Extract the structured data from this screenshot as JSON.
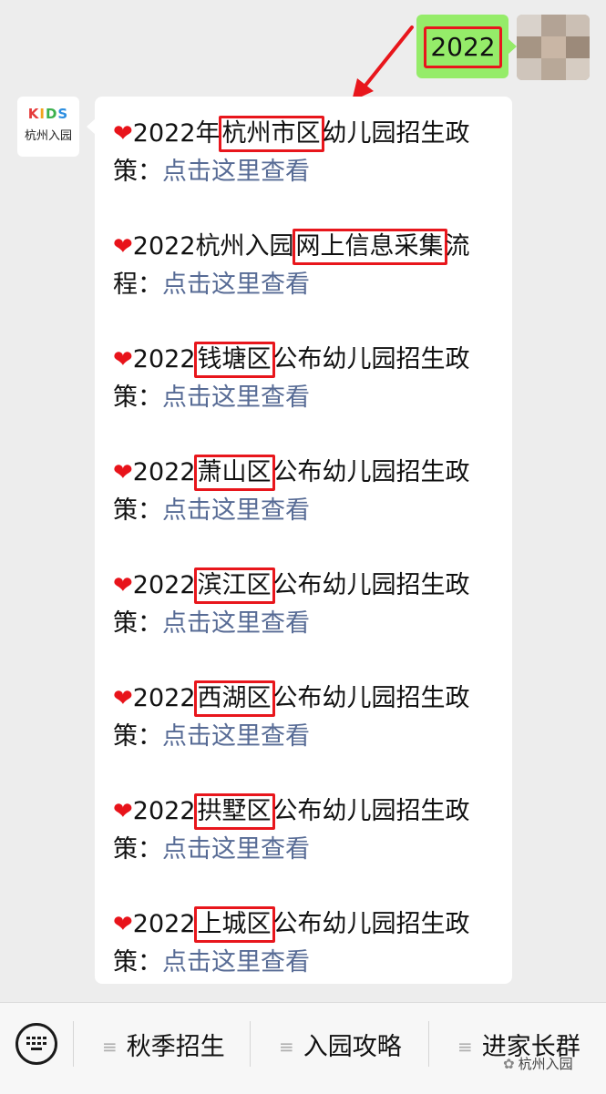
{
  "user_message": {
    "text": "2022"
  },
  "bot": {
    "avatar_logo_letters": [
      "K",
      "I",
      "D",
      "S"
    ],
    "avatar_subtitle": "杭州入园",
    "items": [
      {
        "prefix": "2022年",
        "highlight": "杭州市区",
        "suffix": "幼儿园招生政",
        "line2_prefix": "策：",
        "link": "点击这里查看"
      },
      {
        "prefix": "2022杭州入园",
        "highlight": "网上信息采集",
        "suffix": "流",
        "line2_prefix": "程：",
        "link": "点击这里查看"
      },
      {
        "prefix": "2022",
        "highlight": "钱塘区",
        "suffix": "公布幼儿园招生政",
        "line2_prefix": "策：",
        "link": "点击这里查看"
      },
      {
        "prefix": "2022",
        "highlight": "萧山区",
        "suffix": "公布幼儿园招生政",
        "line2_prefix": "策：",
        "link": "点击这里查看"
      },
      {
        "prefix": "2022",
        "highlight": "滨江区",
        "suffix": "公布幼儿园招生政",
        "line2_prefix": "策：",
        "link": "点击这里查看"
      },
      {
        "prefix": "2022",
        "highlight": "西湖区",
        "suffix": "公布幼儿园招生政",
        "line2_prefix": "策：",
        "link": "点击这里查看"
      },
      {
        "prefix": "2022",
        "highlight": "拱墅区",
        "suffix": "公布幼儿园招生政",
        "line2_prefix": "策：",
        "link": "点击这里查看"
      },
      {
        "prefix": "2022",
        "highlight": "上城区",
        "suffix": "公布幼儿园招生政",
        "line2_prefix": "策：",
        "link": "点击这里查看"
      }
    ]
  },
  "menu": {
    "icon_keyboard": "keyboard-icon",
    "items": [
      "秋季招生",
      "入园攻略",
      "进家长群"
    ]
  },
  "watermark": {
    "text": "杭州入园"
  },
  "colors": {
    "highlight_border": "#e8161c",
    "link": "#576b95",
    "user_bubble": "#95ec69",
    "heart": "#e8131a"
  }
}
